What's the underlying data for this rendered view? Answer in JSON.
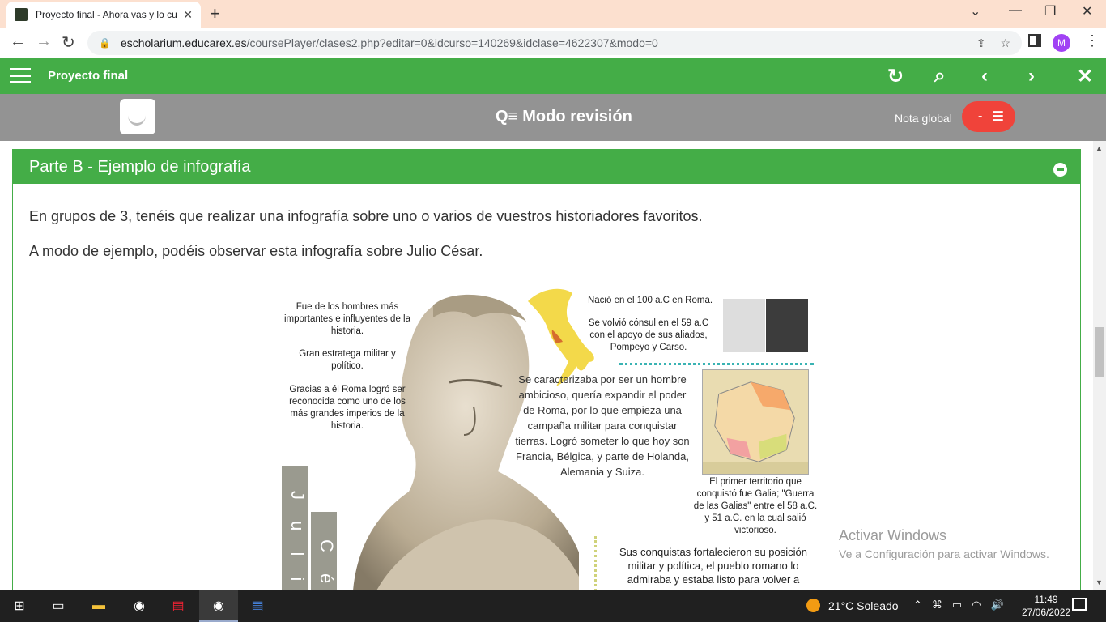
{
  "browser": {
    "tab_title": "Proyecto final - Ahora vas y lo cu",
    "url_host": "escholarium.educarex.es",
    "url_path": "/coursePlayer/clases2.php?editar=0&idcurso=140269&idclase=4622307&modo=0",
    "profile_initial": "M"
  },
  "topbar": {
    "title": "Proyecto final"
  },
  "review_bar": {
    "mode_label": "Modo revisión",
    "grade_label": "Nota global",
    "grade_value": "-"
  },
  "section": {
    "title": "Parte B - Ejemplo de infografía",
    "paragraph1": "En grupos de 3, tenéis que realizar una infografía sobre uno o varios de vuestros historiadores favoritos.",
    "paragraph2": "A modo de ejemplo, podéis observar esta infografía sobre Julio César."
  },
  "infographic": {
    "left_text1": "Fue de los hombres más importantes e influyentes de la historia.",
    "left_text2": "Gran estratega militar y político.",
    "left_text3": "Gracias a él Roma logró ser reconocida como uno de los más grandes imperios de la historia.",
    "born": "Nació  en el 100 a.C en Roma.",
    "consul": "Se volvió cónsul en el 59 a.C con el apoyo de sus aliados, Pompeyo y Carso.",
    "body": "Se caracterizaba por ser un hombre ambicioso, quería expandir el poder de Roma, por lo que empieza una campaña militar para conquistar tierras. Logró someter lo que hoy son Francia, Bélgica, y parte de Holanda, Alemania y Suiza.",
    "gallia": "El primer territorio que conquistó fue Galia; \"Guerra de las Galias\" entre el 58 a.C. y 51 a.C. en la cual salió victorioso.",
    "conquests": "Sus conquistas fortalecieron su posición militar y política, el pueblo romano lo admiraba y estaba listo para volver a",
    "name_col1": "J u l i",
    "name_col2": "C é"
  },
  "watermark": {
    "line1": "Activar Windows",
    "line2": "Ve a Configuración para activar Windows."
  },
  "taskbar": {
    "weather": "21°C  Soleado",
    "time": "11:49",
    "date": "27/06/2022"
  }
}
